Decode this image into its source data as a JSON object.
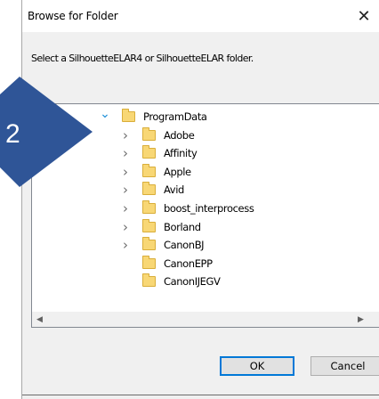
{
  "dialog": {
    "title": "Browse for Folder",
    "close_glyph": "✕",
    "instruction": "Select a SilhouetteELAR4 or SilhouetteELAR folder."
  },
  "callout": {
    "number": "2",
    "color": "#2f5597"
  },
  "tree": {
    "items": [
      {
        "label": "ProgramData",
        "depth": 0,
        "expanded": true,
        "has_children": true
      },
      {
        "label": "Adobe",
        "depth": 1,
        "expanded": false,
        "has_children": true
      },
      {
        "label": "Affinity",
        "depth": 1,
        "expanded": false,
        "has_children": true
      },
      {
        "label": "Apple",
        "depth": 1,
        "expanded": false,
        "has_children": true
      },
      {
        "label": "Avid",
        "depth": 1,
        "expanded": false,
        "has_children": true
      },
      {
        "label": "boost_interprocess",
        "depth": 1,
        "expanded": false,
        "has_children": true
      },
      {
        "label": "Borland",
        "depth": 1,
        "expanded": false,
        "has_children": true
      },
      {
        "label": "CanonBJ",
        "depth": 1,
        "expanded": false,
        "has_children": true
      },
      {
        "label": "CanonEPP",
        "depth": 1,
        "expanded": false,
        "has_children": false
      },
      {
        "label": "CanonIJEGV",
        "depth": 1,
        "expanded": false,
        "has_children": false
      }
    ]
  },
  "scrollbars": {
    "up": "▲",
    "down": "▼",
    "left": "◀",
    "right": "▶"
  },
  "buttons": {
    "ok_label": "OK",
    "cancel_label": "Cancel"
  },
  "colors": {
    "accent": "#0078d7",
    "chevron_open": "#1d8fd8",
    "folder_fill": "#f8d775"
  }
}
